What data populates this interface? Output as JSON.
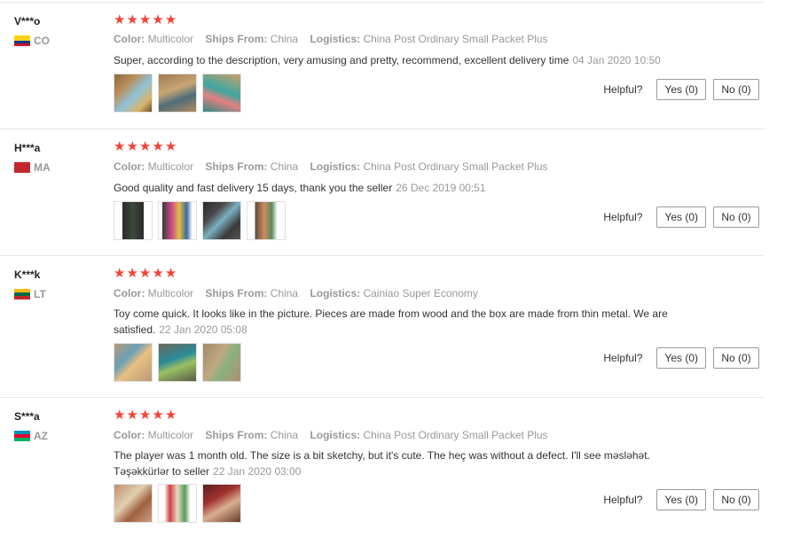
{
  "helpful_label": "Helpful?",
  "star_glyph": "★",
  "colors": {
    "star": "#f44336",
    "muted": "#999999",
    "text": "#333333"
  },
  "attribute_labels": {
    "color": "Color:",
    "ships_from": "Ships From:",
    "logistics": "Logistics:"
  },
  "reviews": [
    {
      "user": "V***o",
      "country": "CO",
      "flag": [
        "#fcd116",
        "#fcd116",
        "#003893",
        "#ce1126"
      ],
      "rating": 5,
      "color": "Multicolor",
      "ships_from": "China",
      "logistics": "China Post Ordinary Small Packet Plus",
      "text": "Super, according to the description, very amusing and pretty, recommend, excellent delivery time",
      "date": "04 Jan 2020 10:50",
      "photos": [
        "photo-1",
        "photo-2",
        "photo-3"
      ],
      "yes": "Yes (0)",
      "no": "No (0)"
    },
    {
      "user": "H***a",
      "country": "MA",
      "flag": [
        "#c1272d"
      ],
      "rating": 5,
      "color": "Multicolor",
      "ships_from": "China",
      "logistics": "China Post Ordinary Small Packet Plus",
      "text": "Good quality and fast delivery 15 days, thank you the seller",
      "date": "26 Dec 2019 00:51",
      "photos": [
        "photo-1",
        "photo-2",
        "photo-3",
        "photo-4"
      ],
      "yes": "Yes (0)",
      "no": "No (0)"
    },
    {
      "user": "K***k",
      "country": "LT",
      "flag": [
        "#fdb913",
        "#006a44",
        "#c1272d"
      ],
      "rating": 5,
      "color": "Multicolor",
      "ships_from": "China",
      "logistics": "Cainiao Super Economy",
      "text": "Toy come quick. It looks like in the picture. Pieces are made from wood and the box are made from thin metal. We are satisfied.",
      "date": "22 Jan 2020 05:08",
      "photos": [
        "photo-1",
        "photo-2",
        "photo-3"
      ],
      "yes": "Yes (0)",
      "no": "No (0)"
    },
    {
      "user": "S***a",
      "country": "AZ",
      "flag": [
        "#0092bc",
        "#e4002b",
        "#00af66"
      ],
      "rating": 5,
      "color": "Multicolor",
      "ships_from": "China",
      "logistics": "China Post Ordinary Small Packet Plus",
      "text": "The player was 1 month old. The size is a bit sketchy, but it's cute. The heç was without a defect. I'll see məsləhət. Təşəkkürlər to seller",
      "date": "22 Jan 2020 03:00",
      "photos": [
        "photo-1",
        "photo-2",
        "photo-3"
      ],
      "yes": "Yes (0)",
      "no": "No (0)"
    }
  ]
}
